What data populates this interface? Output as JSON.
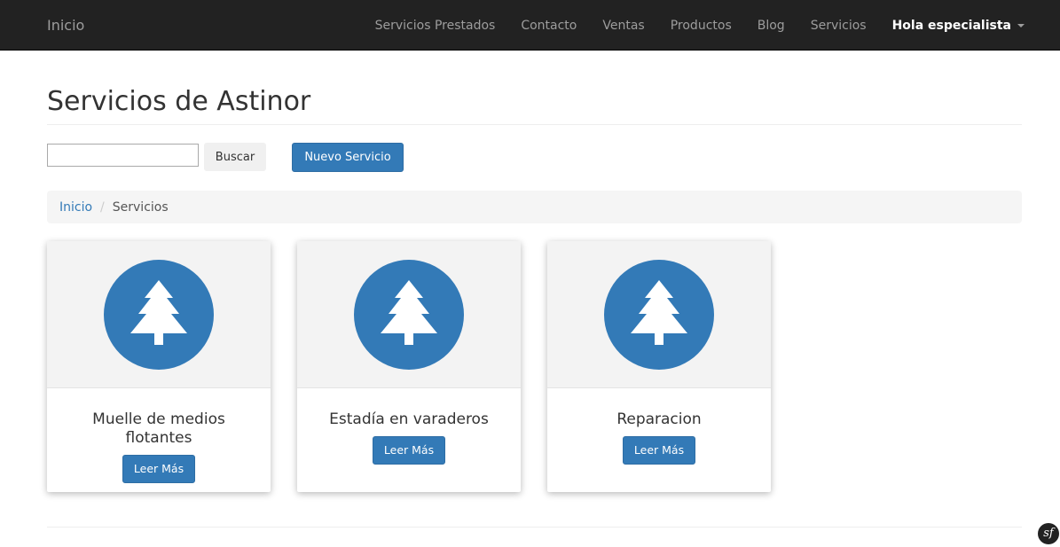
{
  "navbar": {
    "brand": "Inicio",
    "links": [
      "Servicios Prestados",
      "Contacto",
      "Ventas",
      "Productos",
      "Blog",
      "Servicios"
    ],
    "user_label": "Hola especialista"
  },
  "page": {
    "title": "Servicios de Astinor"
  },
  "toolbar": {
    "search_value": "",
    "search_button": "Buscar",
    "new_button": "Nuevo Servicio"
  },
  "breadcrumb": {
    "home": "Inicio",
    "current": "Servicios"
  },
  "cards": [
    {
      "title": "Muelle de medios flotantes",
      "button": "Leer Más",
      "icon": "tree-icon"
    },
    {
      "title": "Estadía en varaderos",
      "button": "Leer Más",
      "icon": "tree-icon"
    },
    {
      "title": "Reparacion",
      "button": "Leer Más",
      "icon": "tree-icon"
    }
  ],
  "colors": {
    "navbar_bg": "#222222",
    "primary": "#337ab7",
    "breadcrumb_bg": "#f5f5f5"
  },
  "debug_toolbar": {
    "glyph": "sf",
    "icon": "symfony-icon"
  }
}
